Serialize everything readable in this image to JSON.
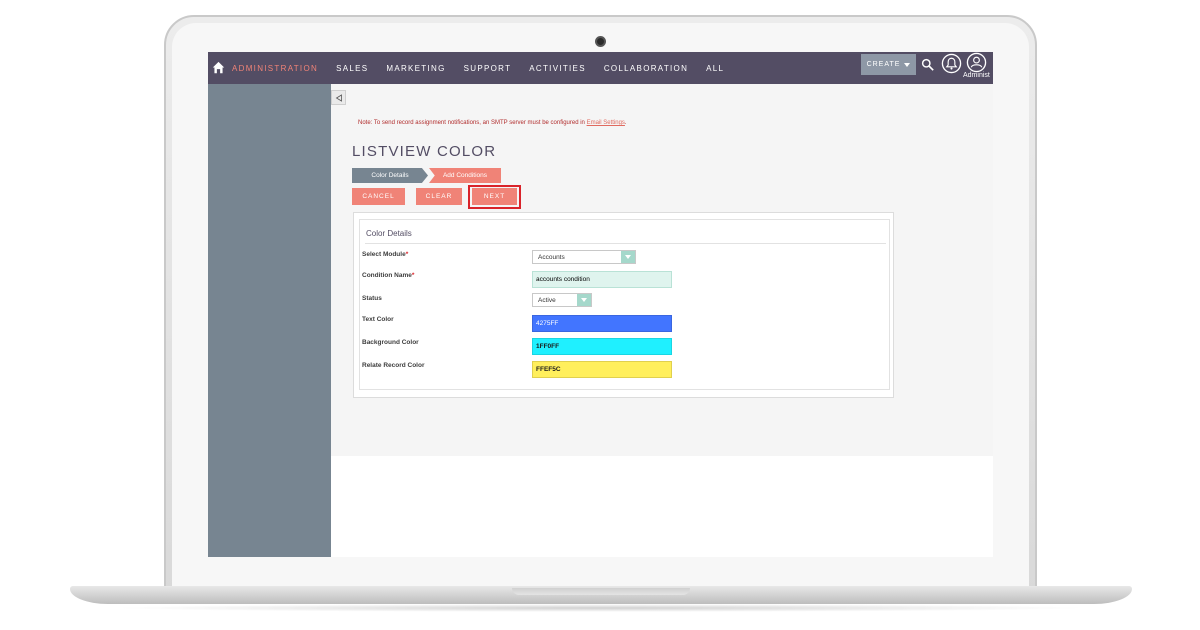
{
  "nav": {
    "items": [
      "ADMINISTRATION",
      "SALES",
      "MARKETING",
      "SUPPORT",
      "ACTIVITIES",
      "COLLABORATION",
      "ALL"
    ],
    "create_label": "CREATE",
    "user_label": "Administ"
  },
  "main": {
    "note_text": "Note: To send record assignment notifications, an SMTP server must be configured in ",
    "note_link": "Email Settings",
    "note_end": ".",
    "title": "LISTVIEW COLOR",
    "steps": [
      "Color Details",
      "Add Conditions"
    ],
    "buttons": {
      "cancel": "CANCEL",
      "clear": "CLEAR",
      "next": "NEXT"
    }
  },
  "panel": {
    "title": "Color Details",
    "fields": [
      {
        "label": "Select Module",
        "required": true,
        "value": "Accounts"
      },
      {
        "label": "Condition Name",
        "required": true,
        "value": "accounts condition"
      },
      {
        "label": "Status",
        "required": false,
        "value": "Active"
      },
      {
        "label": "Text Color",
        "required": false,
        "value": "4275FF",
        "color": "#4275FF"
      },
      {
        "label": "Background Color",
        "required": false,
        "value": "1FF0FF",
        "color": "#1FF0FF"
      },
      {
        "label": "Relate Record Color",
        "required": false,
        "value": "FFEF5C",
        "color": "#FFEF5C"
      }
    ],
    "required_mark": "*"
  },
  "colors": {
    "nav_bg": "#534d64",
    "accent": "#f08377",
    "sidebar_bg": "#778591",
    "highlight": "#d9232a"
  }
}
